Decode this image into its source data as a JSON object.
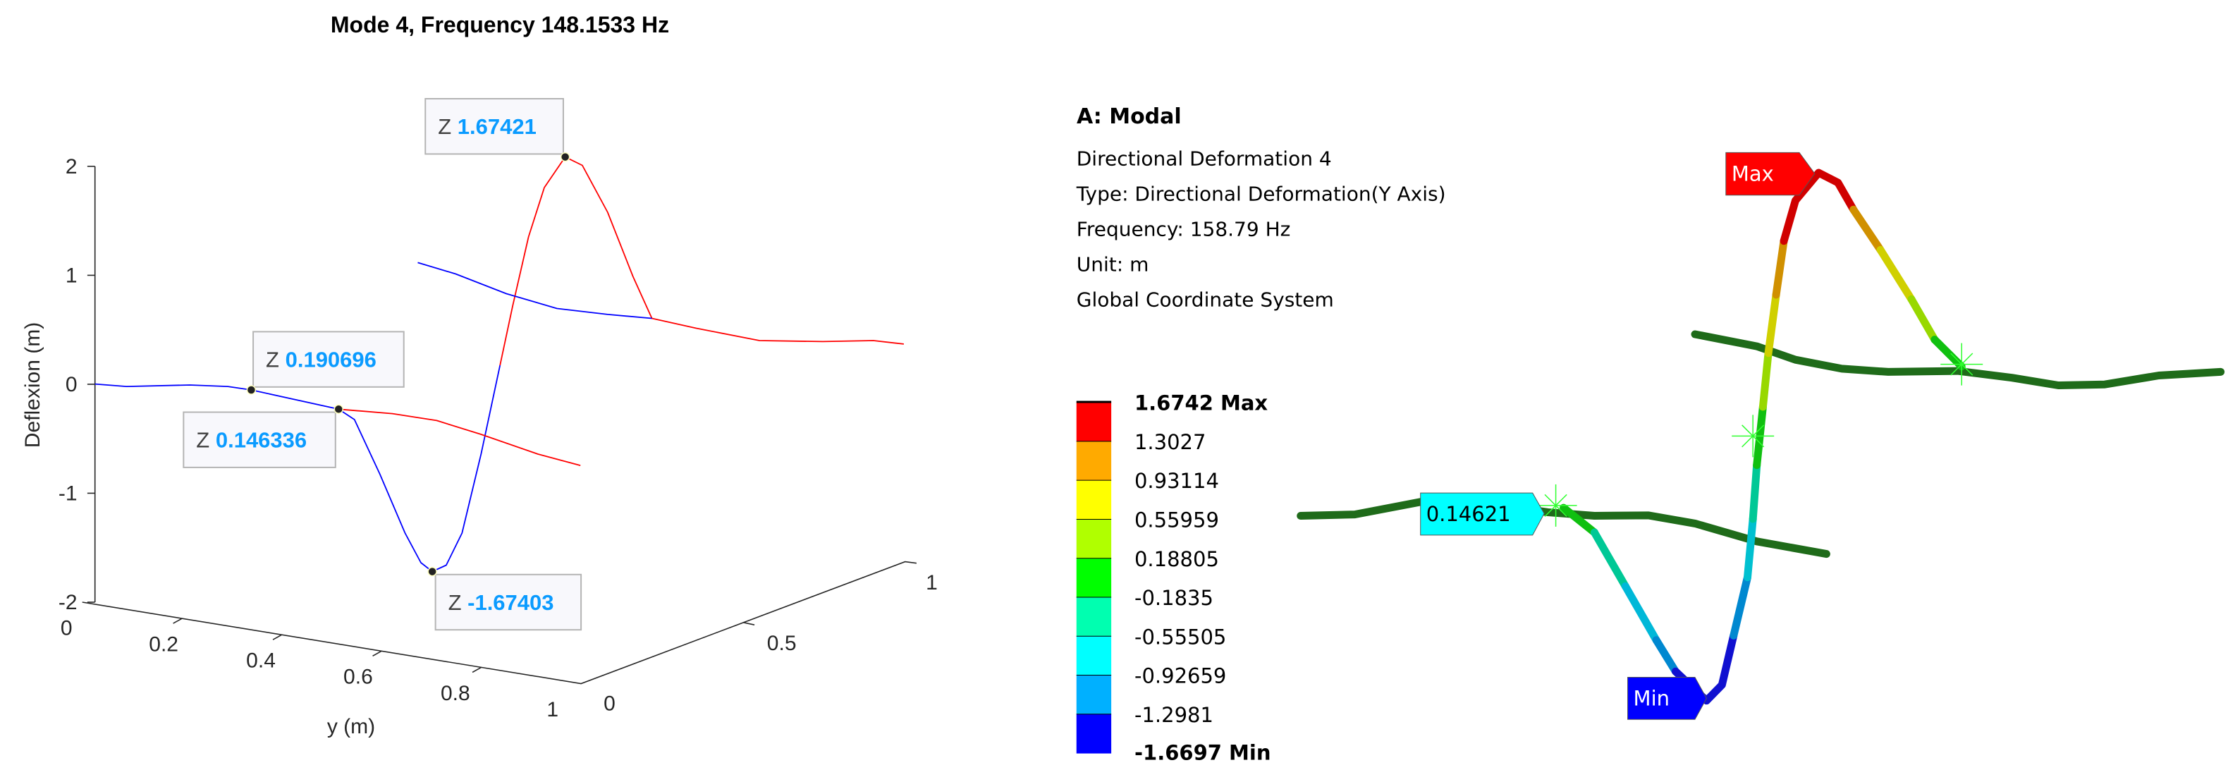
{
  "chart_data": [
    {
      "type": "line",
      "title": "Mode 4, Frequency 148.1533 Hz",
      "xlabel": "y (m)",
      "ylabel": "",
      "zlabel": "Deflexion (m)",
      "x_ticks": [
        "0",
        "0.2",
        "0.4",
        "0.6",
        "0.8",
        "1"
      ],
      "depth_ticks": [
        "0",
        "0.5",
        "1"
      ],
      "z_ticks": [
        "2",
        "1",
        "0",
        "-1",
        "-2"
      ],
      "xlim": [
        0,
        1
      ],
      "depth_lim": [
        0,
        1
      ],
      "zlim": [
        -2,
        2
      ],
      "series_colors": {
        "blue": "#0000ff",
        "red": "#ff0000"
      },
      "datatips": [
        {
          "label": "Z",
          "value": "1.67421"
        },
        {
          "label": "Z",
          "value": "0.190696"
        },
        {
          "label": "Z",
          "value": "0.146336"
        },
        {
          "label": "Z",
          "value": "-1.67403"
        }
      ]
    },
    {
      "type": "heatmap",
      "header": {
        "title": "A: Modal",
        "lines": [
          "Directional Deformation 4",
          "Type: Directional Deformation(Y Axis)",
          "Frequency: 158.79 Hz",
          "Unit: m",
          "Global Coordinate System"
        ]
      },
      "legend": {
        "max_label": "1.6742 Max",
        "min_label": "-1.6697 Min",
        "levels": [
          "1.3027",
          "0.93114",
          "0.55959",
          "0.18805",
          "-0.1835",
          "-0.55505",
          "-0.92659",
          "-1.2981"
        ],
        "colors": [
          "#ff0000",
          "#ffaa00",
          "#ffff00",
          "#b0ff00",
          "#00ff00",
          "#00ffb0",
          "#00ffff",
          "#00b0ff",
          "#0000ff"
        ]
      },
      "probes": {
        "max": "Max",
        "min": "Min",
        "probe_value": "0.14621"
      }
    }
  ]
}
